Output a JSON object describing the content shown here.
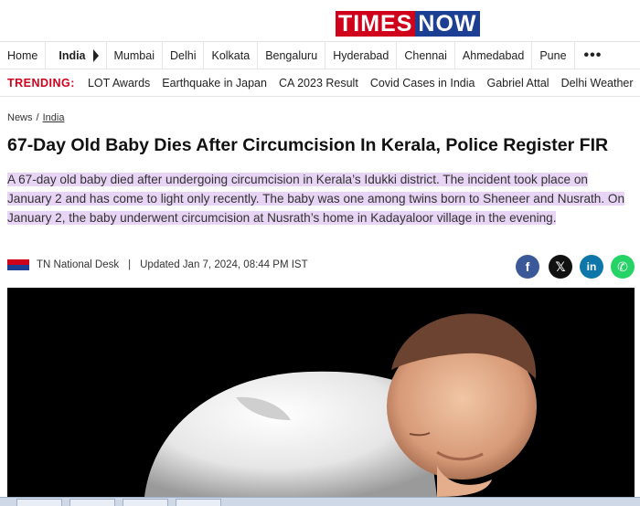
{
  "brand": {
    "logo_part1": "TIMES",
    "logo_part2": "NOW"
  },
  "nav": {
    "items": [
      "Home",
      "India",
      "Mumbai",
      "Delhi",
      "Kolkata",
      "Bengaluru",
      "Hyderabad",
      "Chennai",
      "Ahmedabad",
      "Pune"
    ],
    "more_icon": "more-dots-icon"
  },
  "trending": {
    "label": "TRENDING:",
    "items": [
      "LOT Awards",
      "Earthquake in Japan",
      "CA 2023 Result",
      "Covid Cases in India",
      "Gabriel Attal",
      "Delhi Weather"
    ]
  },
  "breadcrumb": {
    "home": "News",
    "section": "India"
  },
  "article": {
    "title": "67-Day Old Baby Dies After Circumcision In Kerala, Police Register FIR",
    "summary": "A 67-day old baby died after undergoing circumcision in Kerala’s Idukki district. The incident took place on January 2 and has come to light only recently. The baby was one among twins born to Sheneer and Nusrath. On January 2, the baby underwent circumcision at Nusrath’s home in Kadayaloor village in the evening.",
    "author": "TN National Desk",
    "updated": "Updated Jan 7, 2024, 08:44 PM IST"
  },
  "share": {
    "facebook_icon": "facebook-icon",
    "x_icon": "x-icon",
    "linkedin_icon": "linkedin-icon",
    "whatsapp_icon": "whatsapp-icon",
    "facebook_glyph": "f",
    "x_glyph": "𝕏",
    "linkedin_glyph": "in",
    "whatsapp_glyph": "✆"
  },
  "colors": {
    "brand_red": "#d0021b",
    "brand_blue": "#1c3f94",
    "highlight": "#e8d4f4"
  }
}
